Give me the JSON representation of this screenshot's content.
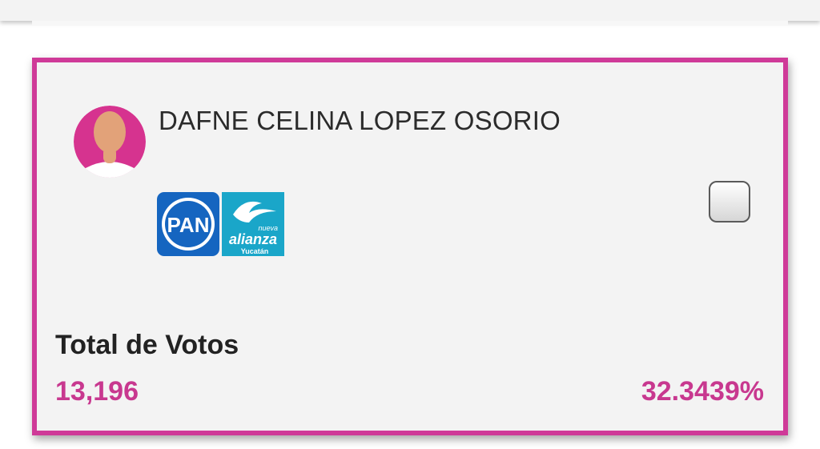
{
  "candidate": {
    "name": "DAFNE CELINA LOPEZ OSORIO",
    "avatar_icon": "female-person-avatar-icon",
    "parties": [
      {
        "label": "PAN",
        "color": "#1565c0"
      },
      {
        "label_small": "nueva",
        "label_main": "alianza",
        "label_region": "Yucatán",
        "color": "#1aa6c9"
      }
    ],
    "selected": false
  },
  "votes": {
    "label": "Total de Votos",
    "count": "13,196",
    "percent": "32.3439%"
  },
  "colors": {
    "accent": "#cf3a98",
    "card_bg": "#f3f3f3"
  }
}
